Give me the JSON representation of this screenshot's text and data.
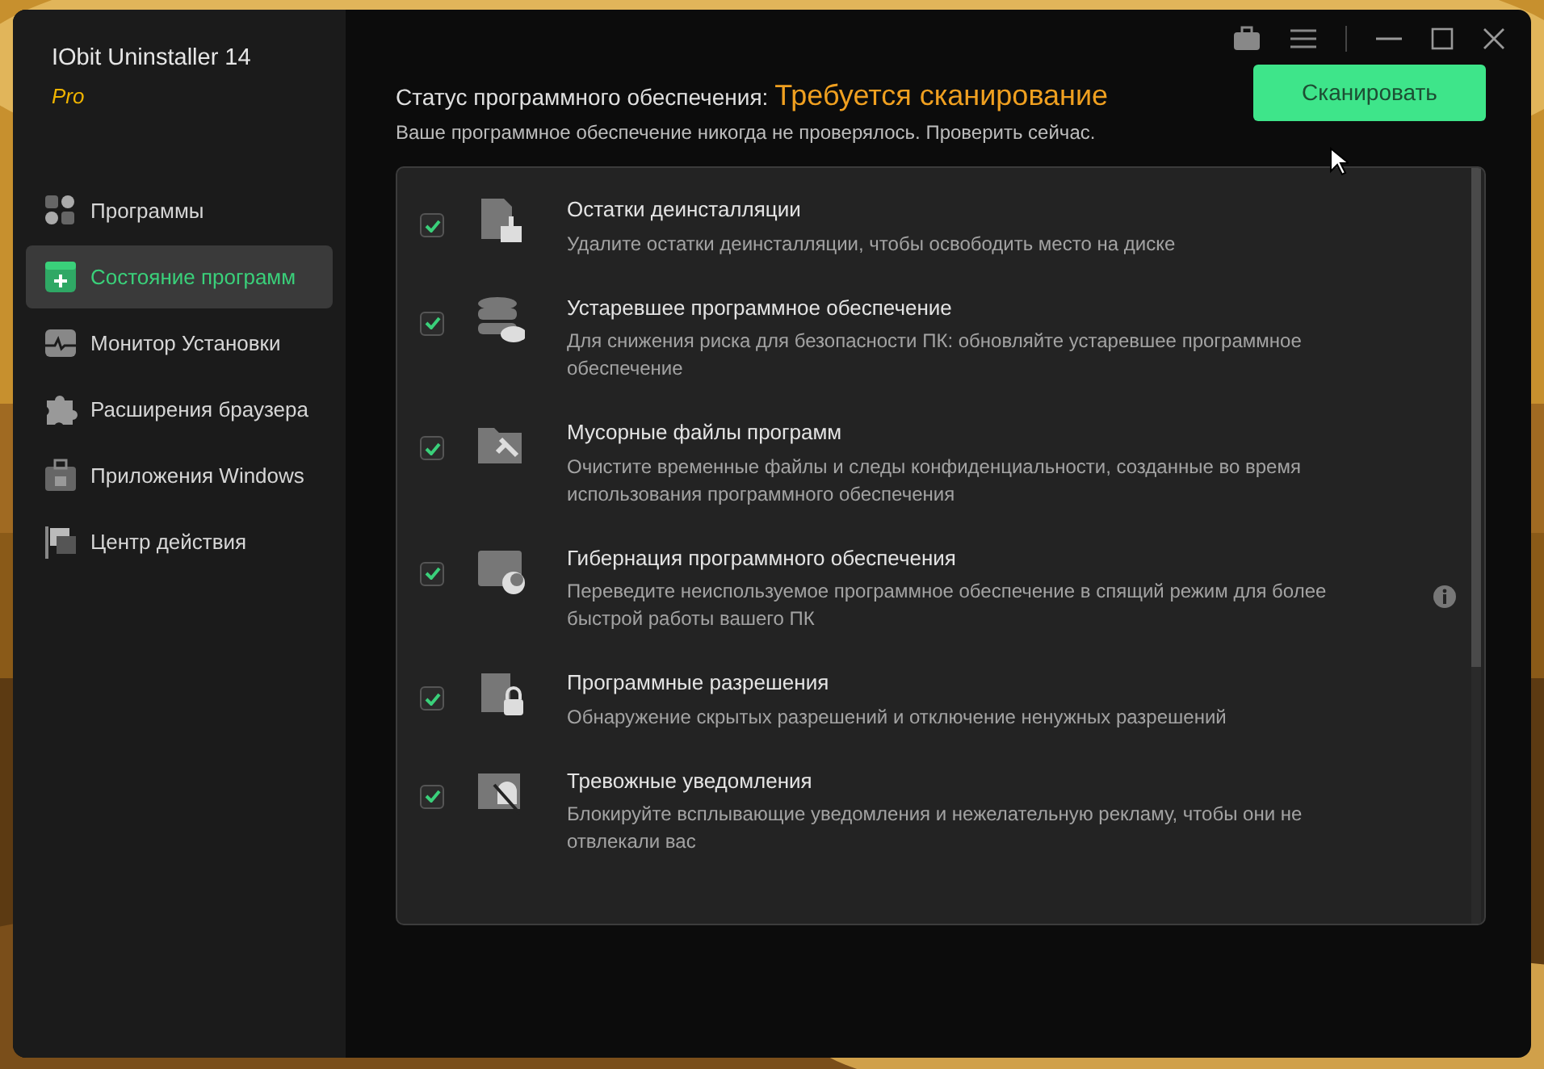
{
  "app": {
    "title": "IObit Uninstaller 14",
    "edition": "Pro"
  },
  "sidebar": {
    "items": [
      {
        "label": "Программы",
        "selected": false
      },
      {
        "label": "Состояние программ",
        "selected": true
      },
      {
        "label": "Монитор Установки",
        "selected": false
      },
      {
        "label": "Расширения браузера",
        "selected": false
      },
      {
        "label": "Приложения Windows",
        "selected": false
      },
      {
        "label": "Центр действия",
        "selected": false
      }
    ]
  },
  "status": {
    "label": "Статус программного обеспечения:",
    "value": "Требуется сканирование",
    "subtitle": "Ваше программное обеспечение никогда не проверялось. Проверить сейчас."
  },
  "scan_button": "Сканировать",
  "items": [
    {
      "title": "Остатки деинсталляции",
      "description": "Удалите остатки деинсталляции, чтобы освободить место на диске",
      "checked": true,
      "info": false
    },
    {
      "title": "Устаревшее программное обеспечение",
      "description": "Для снижения риска для безопасности ПК: обновляйте устаревшее программное обеспечение",
      "checked": true,
      "info": false
    },
    {
      "title": "Мусорные файлы программ",
      "description": "Очистите временные файлы и следы конфиденциальности, созданные во время использования программного обеспечения",
      "checked": true,
      "info": false
    },
    {
      "title": "Гибернация программного обеспечения",
      "description": "Переведите неиспользуемое программное обеспечение в спящий режим для более быстрой работы вашего ПК",
      "checked": true,
      "info": true
    },
    {
      "title": "Программные разрешения",
      "description": "Обнаружение скрытых разрешений и отключение ненужных разрешений",
      "checked": true,
      "info": false
    },
    {
      "title": "Тревожные уведомления",
      "description": "Блокируйте всплывающие уведомления и нежелательную рекламу, чтобы они не отвлекали вас",
      "checked": true,
      "info": false
    }
  ]
}
